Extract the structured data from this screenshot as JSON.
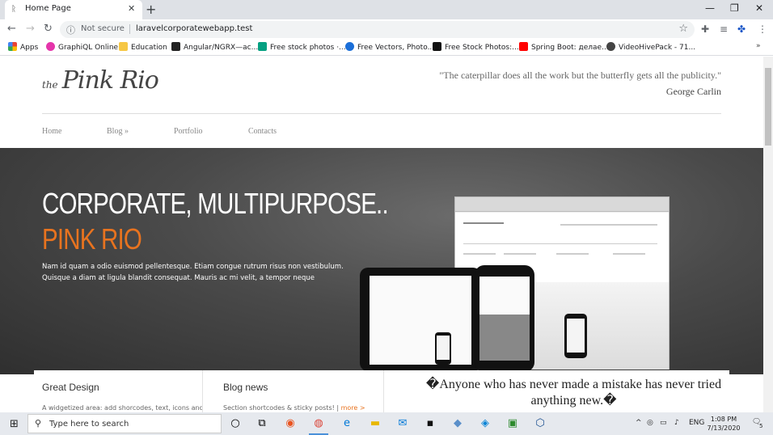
{
  "browser": {
    "tab_title": "Home Page",
    "url_security": "Not secure",
    "url": "laravelcorporatewebapp.test"
  },
  "bookmarks": [
    {
      "label": "Apps",
      "color": "#e94235"
    },
    {
      "label": "GraphiQL Online",
      "color": "#e535ab"
    },
    {
      "label": "Education",
      "color": "#f6c744"
    },
    {
      "label": "Angular/NGRX—ас...",
      "color": "#222222"
    },
    {
      "label": "Free stock photos ·...",
      "color": "#05a081"
    },
    {
      "label": "Free Vectors, Photo...",
      "color": "#1a6ed8"
    },
    {
      "label": "Free Stock Photos:...",
      "color": "#111111"
    },
    {
      "label": "Spring Boot: делае...",
      "color": "#ff0000"
    },
    {
      "label": "VideoHivePack - 71...",
      "color": "#444444"
    }
  ],
  "site": {
    "logo_the": "the",
    "logo_name": "Pink Rio",
    "quote": "\"The caterpillar does all the work but the butterfly gets all the publicity.\"",
    "quote_author": "George Carlin",
    "menu": [
      {
        "label": "Home"
      },
      {
        "label": "Blog »"
      },
      {
        "label": "Portfolio"
      },
      {
        "label": "Contacts"
      }
    ],
    "hero_title_1": "CORPORATE, MULTIPURPOSE..",
    "hero_title_2": "PINK RIO",
    "hero_text": "Nam id quam a odio euismod pellentesque. Etiam congue rutrum risus non vestibulum. Quisque a diam at ligula blandit consequat. Mauris ac mi velit, a tempor neque",
    "accent_color": "#e8731f"
  },
  "boxes": {
    "box1_title": "Great Design",
    "box1_text": "A widgetized area: add shorcodes, text, icons and",
    "box2_title": "Blog news",
    "box2_text": "Section shortcodes & sticky posts! |",
    "box2_more": "more >",
    "quote": "�Anyone who has never made a mistake has never tried anything new.�"
  },
  "taskbar": {
    "search_placeholder": "Type here to search",
    "lang": "ENG",
    "time": "1:08 PM",
    "date": "7/13/2020",
    "notification_count": "5"
  }
}
